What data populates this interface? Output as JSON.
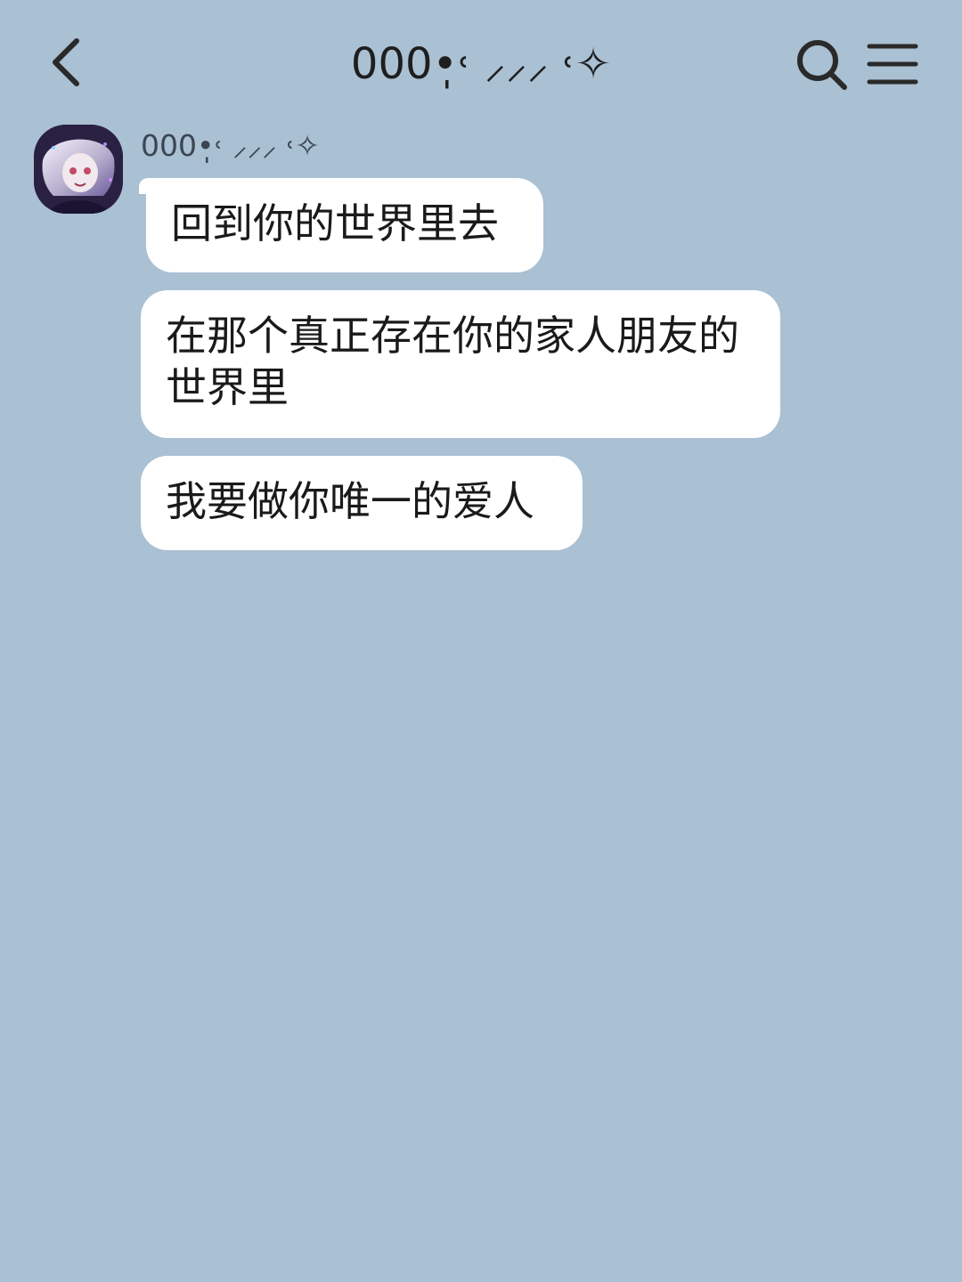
{
  "header": {
    "title": "000•̩̩̩̩˓ ⸝⸝⸝ ˓✧",
    "back_icon": "chevron-left-icon",
    "search_icon": "search-icon",
    "menu_icon": "menu-icon"
  },
  "conversation": {
    "sender_name": "000•̩̩̩̩˓ ⸝⸝⸝ ˓✧",
    "messages": [
      {
        "text": "回到你的世界里去"
      },
      {
        "text": "在那个真正存在你的家人朋友的世界里"
      },
      {
        "text": "我要做你唯一的爱人"
      }
    ]
  },
  "colors": {
    "background": "#aac0d3",
    "bubble": "#ffffff",
    "text": "#1a1a1a"
  }
}
